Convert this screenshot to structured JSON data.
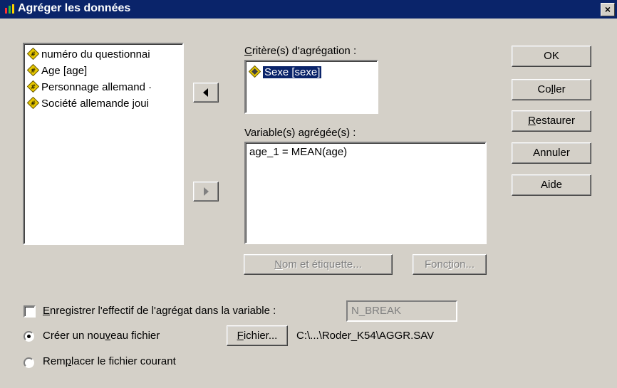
{
  "window": {
    "title": "Agréger les données",
    "close_glyph": "×"
  },
  "source_vars": [
    "numéro du questionnai",
    "Age [age]",
    "Personnage allemand ·",
    "Société allemande joui"
  ],
  "criteria": {
    "label_ul": "C",
    "label_rest": "ritère(s) d'agrégation :",
    "items": [
      "Sexe [sexe]"
    ]
  },
  "aggregated": {
    "label": "Variable(s) agrégée(s) :",
    "items": [
      "age_1 = MEAN(age)"
    ]
  },
  "buttons": {
    "ok": "OK",
    "paste_a": "Co",
    "paste_u": "l",
    "paste_b": "ler",
    "reset_u": "R",
    "reset_b": "estaurer",
    "cancel": "Annuler",
    "help": "Aide",
    "name_label_u": "N",
    "name_label_b": "om et étiquette...",
    "function_a": "Fonc",
    "function_u": "t",
    "function_b": "ion...",
    "file_u": "F",
    "file_b": "ichier..."
  },
  "options": {
    "save_count_u": "E",
    "save_count_b": "nregistrer l'effectif de l'agrégat dans la variable :",
    "save_count_checked": false,
    "break_var": "N_BREAK",
    "create_new_a": "Créer un nou",
    "create_new_u": "v",
    "create_new_b": "eau fichier",
    "create_new_selected": true,
    "file_path": "C:\\...\\Roder_K54\\AGGR.SAV",
    "replace_a": "Rem",
    "replace_u": "p",
    "replace_b": "lacer le fichier courant",
    "replace_selected": false
  },
  "colors": {
    "titlebar": "#0a246a",
    "face": "#d4d0c8",
    "selection": "#0a246a",
    "var_icon": "#e8c800"
  }
}
